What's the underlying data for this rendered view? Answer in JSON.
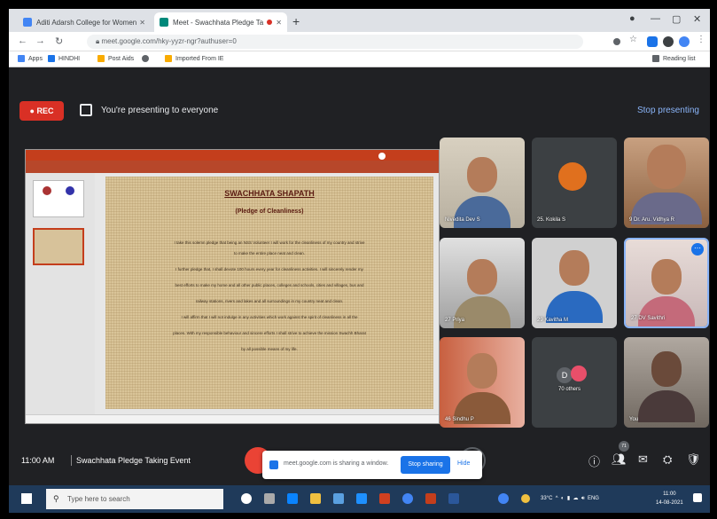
{
  "browser": {
    "tabs": [
      {
        "label": "Aditi Adarsh College for Women",
        "icon_color": "#4285f4"
      },
      {
        "label": "Meet - Swachhata Pledge Ta",
        "icon_color": "#00897b"
      }
    ],
    "url": "meet.google.com/hky-yyzr-ngr?authuser=0",
    "bookmarks": [
      "Apps",
      "HINDHI",
      "Post Aids",
      "Imported From IE"
    ],
    "reading_list": "Reading list"
  },
  "presenting": {
    "rec_label": "REC",
    "message": "You're presenting to everyone",
    "stop_label": "Stop presenting"
  },
  "slide": {
    "title": "SWACHHATA SHAPATH",
    "subtitle": "(Pledge of Cleanliness)",
    "lines": [
      "I take this solemn pledge that being an NSS Volunteer I will work for the cleanliness of my country and strive",
      "to make the entire place neat and clean.",
      "I further pledge that, I shall devote 100 hours every year for cleanliness activities. I will sincerely render my",
      "best efforts to make my home and all other public places, colleges and schools, cities and villages, bus and",
      "railway stations, rivers and lakes and all surroundings in my country neat and clean.",
      "I will affirm that I will not indulge in any activities which work against the spirit of cleanliness in all the",
      "places. With my responsible behaviour and sincere efforts I shall strive to achieve the mission Swachh Bharat",
      "by all possible means of my life."
    ]
  },
  "participants": [
    {
      "name": "Nivedita Dev S",
      "kind": "photo"
    },
    {
      "name": "25. Kokila S",
      "kind": "avatar"
    },
    {
      "name": "9 Dr. Aru. Vidhya R",
      "kind": "photo"
    },
    {
      "name": "27 Priya",
      "kind": "photo"
    },
    {
      "name": "29 Kavitha M",
      "kind": "photo"
    },
    {
      "name": "27 DV Savithri",
      "kind": "photo"
    },
    {
      "name": "46 Sindhu P",
      "kind": "photo"
    },
    {
      "name": "70 others",
      "kind": "others",
      "initial": "D"
    },
    {
      "name": "You",
      "kind": "photo"
    }
  ],
  "meeting": {
    "time": "11:00 AM",
    "title": "Swachhata Pledge Taking Event",
    "people_count": "71"
  },
  "share_notice": {
    "text": "meet.google.com is sharing a window.",
    "stop_label": "Stop sharing",
    "hide_label": "Hide"
  },
  "taskbar": {
    "search_placeholder": "Type here to search",
    "weather": "33°C",
    "lang": "ENG",
    "time": "11:00",
    "date": "14-08-2021"
  },
  "colors": {
    "rec": "#d93025",
    "accent": "#1a73e8",
    "ppt": "#c43e1c"
  }
}
